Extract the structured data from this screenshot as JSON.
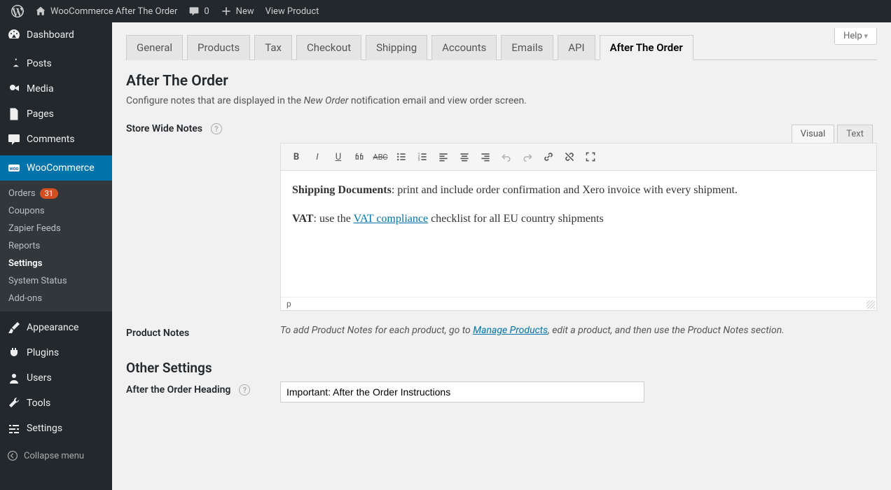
{
  "adminbar": {
    "site_title": "WooCommerce After The Order",
    "comments": "0",
    "new": "New",
    "view_product": "View Product"
  },
  "sidebar": {
    "items": [
      {
        "label": "Dashboard"
      },
      {
        "label": "Posts"
      },
      {
        "label": "Media"
      },
      {
        "label": "Pages"
      },
      {
        "label": "Comments"
      },
      {
        "label": "WooCommerce",
        "active": true
      },
      {
        "label": "Appearance"
      },
      {
        "label": "Plugins"
      },
      {
        "label": "Users"
      },
      {
        "label": "Tools"
      },
      {
        "label": "Settings"
      }
    ],
    "submenu": [
      {
        "label": "Orders",
        "badge": "31"
      },
      {
        "label": "Coupons"
      },
      {
        "label": "Zapier Feeds"
      },
      {
        "label": "Reports"
      },
      {
        "label": "Settings",
        "current": true
      },
      {
        "label": "System Status"
      },
      {
        "label": "Add-ons"
      }
    ],
    "collapse": "Collapse menu"
  },
  "help": "Help",
  "tabs": [
    "General",
    "Products",
    "Tax",
    "Checkout",
    "Shipping",
    "Accounts",
    "Emails",
    "API",
    "After The Order"
  ],
  "active_tab": "After The Order",
  "page": {
    "title": "After The Order",
    "desc_pre": "Configure notes that are displayed in the ",
    "desc_em": "New Order",
    "desc_post": " notification email and view order screen."
  },
  "store_notes": {
    "label": "Store Wide Notes",
    "editor_tabs": {
      "visual": "Visual",
      "text": "Text"
    },
    "content": {
      "p1_strong": "Shipping Documents",
      "p1_rest": ": print and include order confirmation and Xero invoice with every shipment.",
      "p2_strong": "VAT",
      "p2_mid": ": use the ",
      "p2_link": "VAT compliance",
      "p2_rest": " checklist for all EU country shipments"
    },
    "path": "p"
  },
  "product_notes": {
    "label": "Product Notes",
    "desc_pre": "To add Product Notes for each product, go to ",
    "desc_link": "Manage Products",
    "desc_post": ", edit a product, and then use the Product Notes section."
  },
  "other_settings": {
    "title": "Other Settings",
    "heading_label": "After the Order Heading",
    "heading_value": "Important: After the Order Instructions"
  }
}
